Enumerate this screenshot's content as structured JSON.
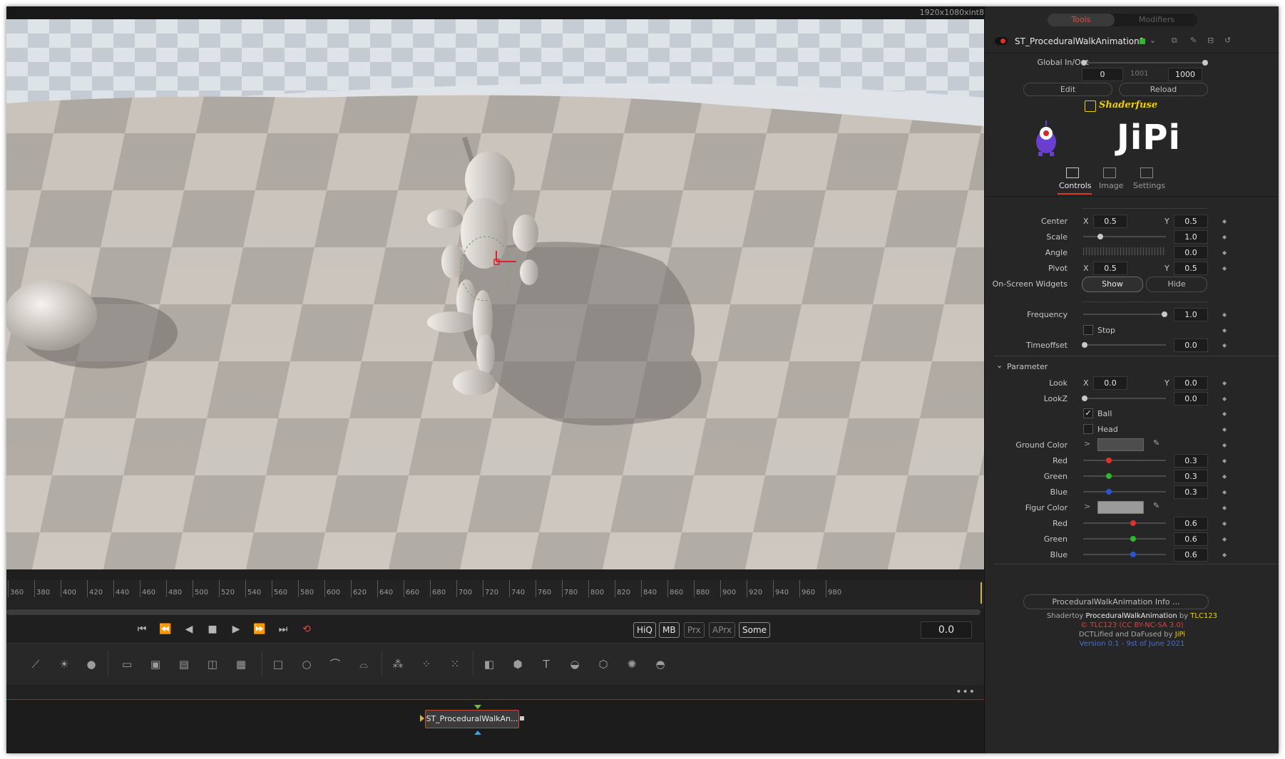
{
  "viewer": {
    "resolution": "1920x1080xint8"
  },
  "timeline": {
    "ticks": [
      "360",
      "380",
      "400",
      "420",
      "440",
      "460",
      "480",
      "500",
      "520",
      "540",
      "560",
      "580",
      "600",
      "620",
      "640",
      "660",
      "680",
      "700",
      "720",
      "740",
      "760",
      "780",
      "800",
      "820",
      "840",
      "860",
      "880",
      "900",
      "920",
      "940",
      "960",
      "980"
    ]
  },
  "transport": {
    "quality_buttons": [
      "HiQ",
      "MB",
      "Prx",
      "APrx",
      "Some"
    ],
    "timecode": "0.0"
  },
  "node_editor": {
    "node_label": "ST_ProceduralWalkAn..."
  },
  "inspector": {
    "tabs": [
      "Tools",
      "Modifiers"
    ],
    "tool_name": "ST_ProceduralWalkAnimation1",
    "global_inout": {
      "label": "Global In/Out",
      "in": "0",
      "mid": "1001",
      "out": "1000"
    },
    "edit_label": "Edit",
    "reload_label": "Reload",
    "shaderfuse_label": "Shaderfuse",
    "jipi_logo": "JiPi",
    "subtabs": [
      "Controls",
      "Image",
      "Settings"
    ],
    "center": {
      "label": "Center",
      "x": "0.5",
      "y": "0.5"
    },
    "scale": {
      "label": "Scale",
      "value": "1.0"
    },
    "angle": {
      "label": "Angle",
      "value": "0.0"
    },
    "pivot": {
      "label": "Pivot",
      "x": "0.5",
      "y": "0.5"
    },
    "widgets": {
      "label": "On-Screen Widgets",
      "show": "Show",
      "hide": "Hide"
    },
    "frequency": {
      "label": "Frequency",
      "value": "1.0"
    },
    "stop_label": "Stop",
    "timeoffset": {
      "label": "Timeoffset",
      "value": "0.0"
    },
    "parameter_label": "Parameter",
    "look": {
      "label": "Look",
      "x": "0.0",
      "y": "0.0"
    },
    "lookz": {
      "label": "LookZ",
      "value": "0.0"
    },
    "ball_label": "Ball",
    "head_label": "Head",
    "ground": {
      "label": "Ground Color",
      "red": "0.3",
      "green": "0.3",
      "blue": "0.3"
    },
    "figur": {
      "label": "Figur Color",
      "red": "0.6",
      "green": "0.6",
      "blue": "0.6"
    },
    "red_label": "Red",
    "green_label": "Green",
    "blue_label": "Blue",
    "xlbl": "X",
    "ylbl": "Y",
    "info_button": "ProceduralWalkAnimation Info ...",
    "credits": {
      "line1_pre": "Shadertoy ",
      "line1_name": "ProceduralWalkAnimation",
      "line1_by": " by ",
      "line1_author": "TLC123",
      "line2": "© TLC123 (CC BY-NC-SA 3.0)",
      "line3_pre": "DCTLified and DaFused by ",
      "line3_author": "JiPi",
      "line4": "Version 0.1 - 9st of June 2021"
    }
  },
  "colors": {
    "accent_red": "#c0392b",
    "highlight_yellow": "#f0d000",
    "version_blue": "#4a6fd8",
    "credit_red": "#e04040"
  }
}
